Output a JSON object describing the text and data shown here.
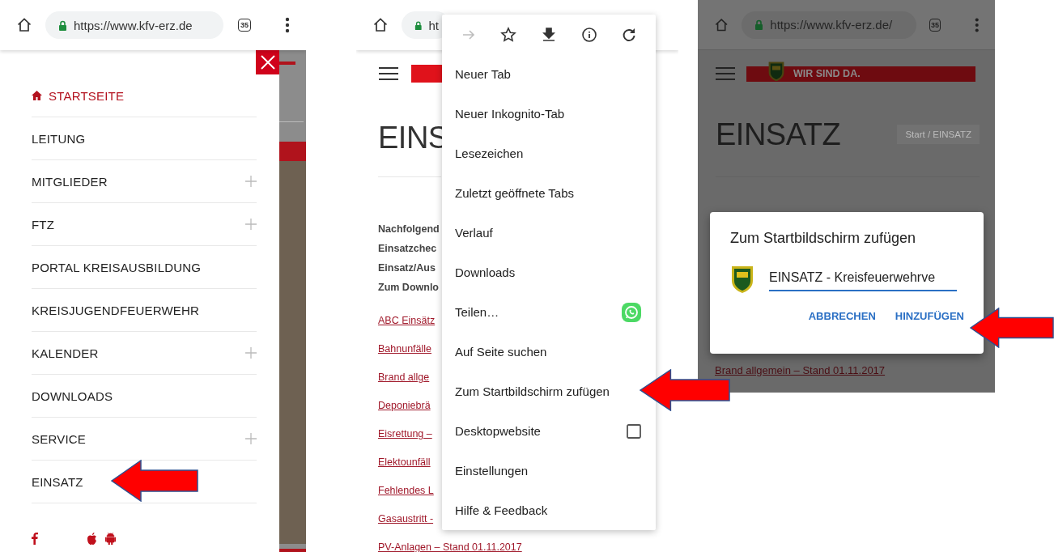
{
  "drawer_screen": {
    "url": "https://www.kfv-erz.de",
    "tab_count": "35",
    "menu": [
      {
        "label": "STARTSEITE",
        "selected": true,
        "expandable": false
      },
      {
        "label": "LEITUNG",
        "selected": false,
        "expandable": false
      },
      {
        "label": "MITGLIEDER",
        "selected": false,
        "expandable": true
      },
      {
        "label": "FTZ",
        "selected": false,
        "expandable": true
      },
      {
        "label": "PORTAL KREISAUSBILDUNG",
        "selected": false,
        "expandable": false
      },
      {
        "label": "KREISJUGENDFEUERWEHR",
        "selected": false,
        "expandable": false
      },
      {
        "label": "KALENDER",
        "selected": false,
        "expandable": true
      },
      {
        "label": "DOWNLOADS",
        "selected": false,
        "expandable": false
      },
      {
        "label": "SERVICE",
        "selected": false,
        "expandable": true
      },
      {
        "label": "EINSATZ",
        "selected": false,
        "expandable": false
      }
    ]
  },
  "menu_screen": {
    "url": "ht",
    "page": {
      "title": "EINS",
      "intro": [
        "Nachfolgend",
        "Einsatzchec",
        "Einsatz/Aus",
        "Zum Downlo"
      ],
      "links": [
        "ABC Einsätz",
        "Bahnunfälle",
        "Brand allge",
        "Deponiebrä",
        "Eisrettung –",
        "Elektounfäll",
        "Fehlendes L",
        "Gasaustritt -",
        "PV-Anlagen – Stand 01.11.2017"
      ]
    },
    "toolbar": [
      {
        "kind": "forward",
        "disabled": true
      },
      {
        "kind": "bookmark",
        "disabled": false
      },
      {
        "kind": "download",
        "disabled": false
      },
      {
        "kind": "info",
        "disabled": false
      },
      {
        "kind": "reload",
        "disabled": false
      }
    ],
    "menu": [
      {
        "label": "Neuer Tab",
        "kind": "plain"
      },
      {
        "label": "Neuer Inkognito-Tab",
        "kind": "plain"
      },
      {
        "label": "Lesezeichen",
        "kind": "plain"
      },
      {
        "label": "Zuletzt geöffnete Tabs",
        "kind": "plain"
      },
      {
        "label": "Verlauf",
        "kind": "plain"
      },
      {
        "label": "Downloads",
        "kind": "plain"
      },
      {
        "label": "Teilen…",
        "kind": "share"
      },
      {
        "label": "Auf Seite suchen",
        "kind": "plain"
      },
      {
        "label": "Zum Startbildschirm zufügen",
        "kind": "plain"
      },
      {
        "label": "Desktopwebsite",
        "kind": "checkbox",
        "checked": false
      },
      {
        "label": "Einstellungen",
        "kind": "plain"
      },
      {
        "label": "Hilfe & Feedback",
        "kind": "plain"
      }
    ]
  },
  "dialog_screen": {
    "url": "https://www.kfv-erz.de/",
    "tab_count": "35",
    "logo_text": "WIR SIND DA.",
    "page": {
      "title": "EINSATZ",
      "breadcrumb": "Start / EINSATZ",
      "links": [
        "Brand allgemein – Stand 01.11.2017"
      ]
    },
    "dialog": {
      "title": "Zum Startbildschirm zufügen",
      "value": "EINSATZ - Kreisfeuerwehrve",
      "buttons": [
        "ABBRECHEN",
        "HINZUFÜGEN"
      ]
    }
  }
}
